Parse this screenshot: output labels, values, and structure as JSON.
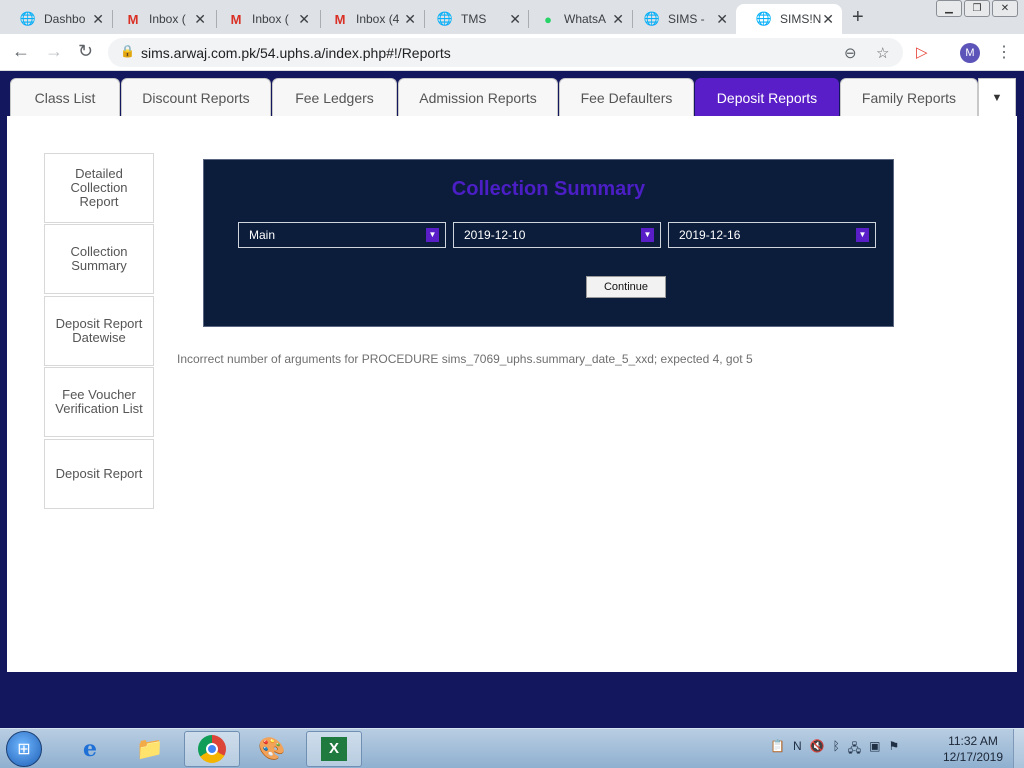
{
  "browser": {
    "tabs": [
      {
        "label": "Dashbo",
        "icon": "globe-icon"
      },
      {
        "label": "Inbox (",
        "icon": "gmail-icon"
      },
      {
        "label": "Inbox (",
        "icon": "gmail-icon"
      },
      {
        "label": "Inbox (4",
        "icon": "gmail-icon"
      },
      {
        "label": "TMS",
        "icon": "globe-icon"
      },
      {
        "label": "WhatsA",
        "icon": "whatsapp-icon"
      },
      {
        "label": "SIMS - ",
        "icon": "globe-icon"
      },
      {
        "label": "SIMS!N",
        "icon": "globe-icon",
        "active": true
      }
    ],
    "new_tab": "+",
    "url": "sims.arwaj.com.pk/54.uphs.a/index.php#!/Reports",
    "avatar_letter": "M"
  },
  "report_tabs": [
    "Class List",
    "Discount Reports",
    "Fee Ledgers",
    "Admission Reports",
    "Fee Defaulters",
    "Deposit Reports",
    "Family Reports"
  ],
  "active_report_tab": "Deposit Reports",
  "sidebar": [
    "Detailed Collection Report",
    "Collection Summary",
    "Deposit Report Datewise",
    "Fee Voucher Verification List",
    "Deposit Report"
  ],
  "panel": {
    "title": "Collection Summary",
    "campus_select": "Main",
    "from_date": "2019-12-10",
    "to_date": "2019-12-16",
    "continue_label": "Continue"
  },
  "error_message": "Incorrect number of arguments for PROCEDURE sims_7069_uphs.summary_date_5_xxd; expected 4, got 5",
  "taskbar": {
    "time": "11:32 AM",
    "date": "12/17/2019"
  },
  "colors": {
    "accent_purple": "#5a1ec8",
    "panel_bg": "#0c1d3b",
    "page_bg": "#13185e",
    "title_purple": "#4b1ec6"
  }
}
